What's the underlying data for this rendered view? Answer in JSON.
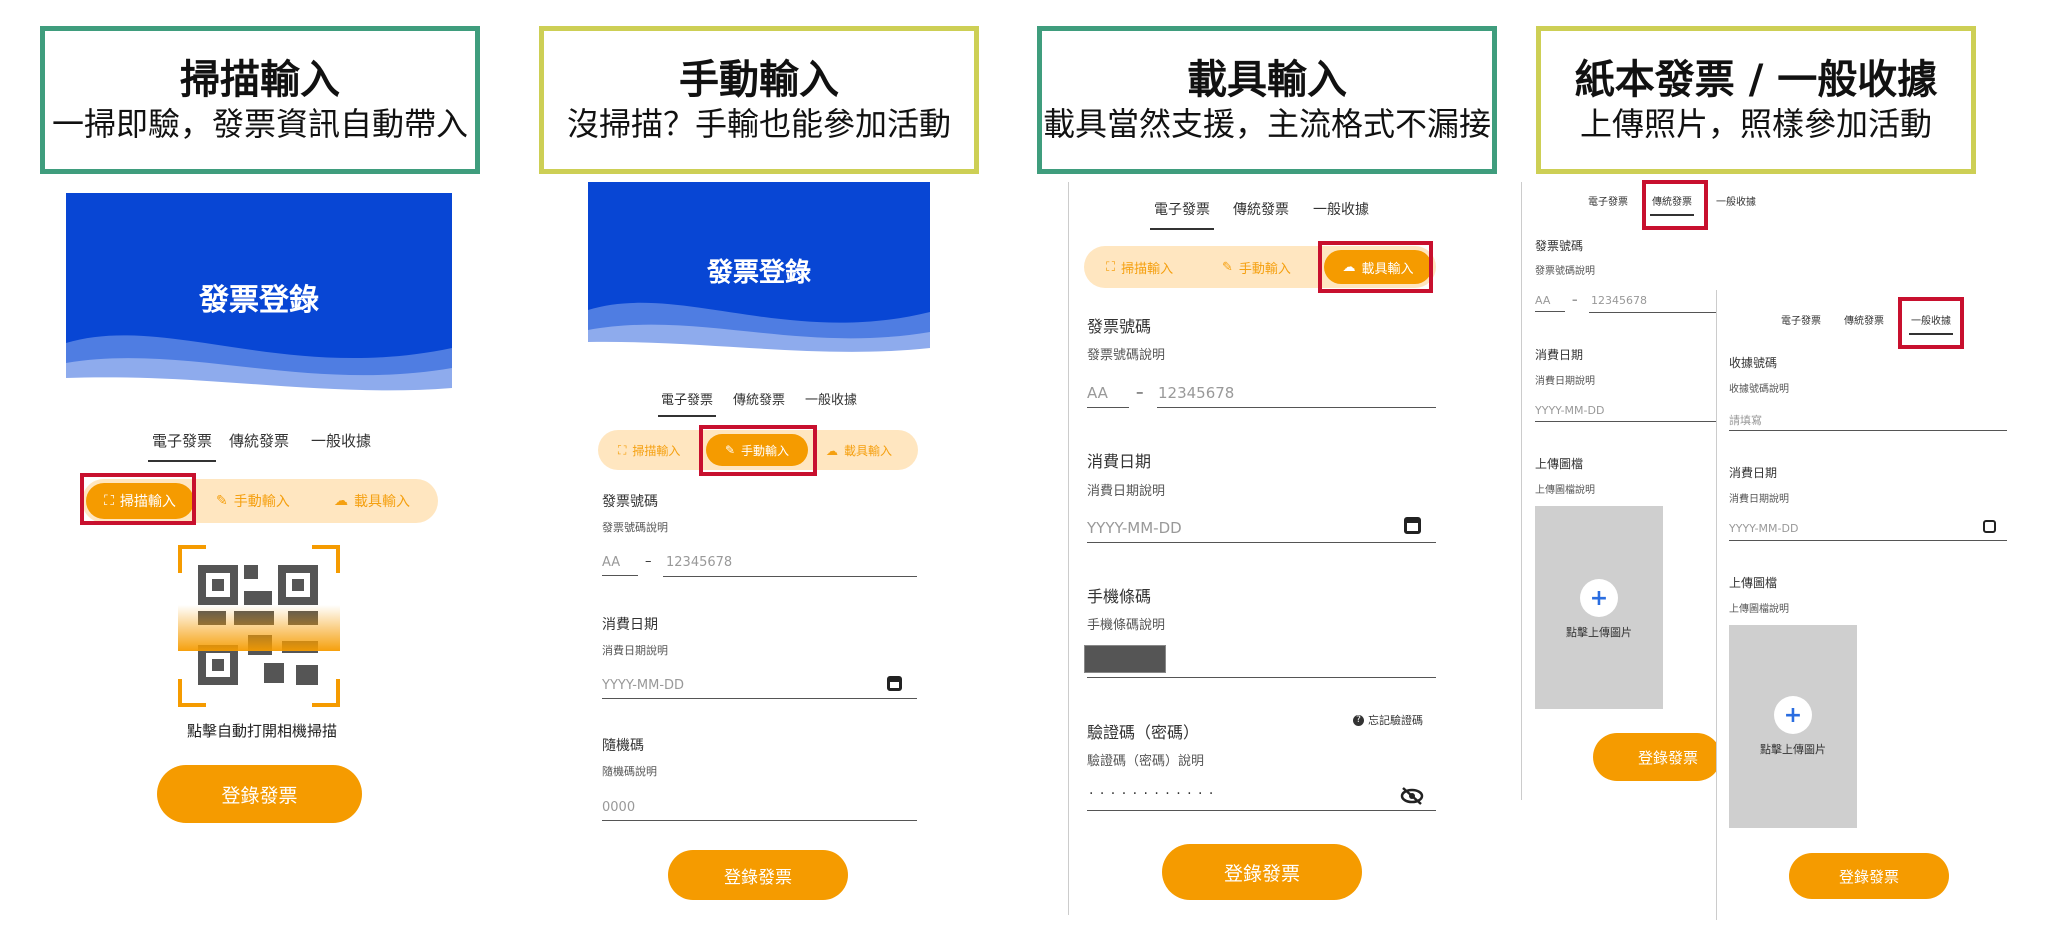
{
  "headers": [
    {
      "title": "掃描輸入",
      "subtitle": "一掃即驗，發票資訊自動帶入"
    },
    {
      "title": "手動輸入",
      "subtitle": "沒掃描？手輸也能參加活動"
    },
    {
      "title": "載具輸入",
      "subtitle": "載具當然支援，主流格式不漏接"
    },
    {
      "title": "紙本發票 / 一般收據",
      "subtitle": "上傳照片，照樣參加活動"
    }
  ],
  "hero_title": "發票登錄",
  "tabs": [
    "電子發票",
    "傳統發票",
    "一般收據"
  ],
  "modes": [
    "掃描輸入",
    "手動輸入",
    "載具輸入"
  ],
  "scan_hint": "點擊自動打開相機掃描",
  "submit": "登錄發票",
  "fields": {
    "invoice_no": "發票號碼",
    "invoice_no_hint": "發票號碼說明",
    "prefix_ph": "AA",
    "dash": "–",
    "number_ph": "12345678",
    "date": "消費日期",
    "date_hint": "消費日期說明",
    "date_ph": "YYYY-MM-DD",
    "random": "隨機碼",
    "random_hint": "隨機碼說明",
    "random_ph": "0000",
    "barcode": "手機條碼",
    "barcode_hint": "手機條碼說明",
    "verify": "驗證碼（密碼）",
    "verify_hint": "驗證碼（密碼）說明",
    "forgot": "忘記驗證碼",
    "password_mask": "· · · · · · · · · · · ·",
    "upload": "上傳圖檔",
    "upload_hint": "上傳圖檔說明",
    "upload_btn": "點擊上傳圖片",
    "receipt_no": "收據號碼",
    "receipt_no_hint": "收據號碼說明",
    "receipt_ph": "請填寫"
  },
  "colors": {
    "accent": "#f59b00",
    "hero": "#0846d4",
    "highlight": "#c8102e"
  }
}
